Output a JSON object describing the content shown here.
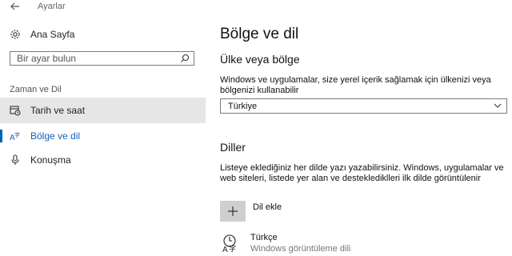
{
  "window": {
    "title": "Ayarlar"
  },
  "sidebar": {
    "home_label": "Ana Sayfa",
    "search_placeholder": "Bir ayar bulun",
    "section_label": "Zaman ve Dil",
    "items": [
      {
        "label": "Tarih ve saat",
        "icon": "calendar-clock-icon",
        "state": "selected"
      },
      {
        "label": "Bölge ve dil",
        "icon": "language-icon",
        "state": "active"
      },
      {
        "label": "Konuşma",
        "icon": "microphone-icon",
        "state": "normal"
      }
    ]
  },
  "main": {
    "title": "Bölge ve dil",
    "region": {
      "heading": "Ülke veya bölge",
      "description": "Windows ve uygulamalar, size yerel içerik sağlamak için ülkenizi veya bölgenizi kullanabilir",
      "selected_value": "Türkiye"
    },
    "languages": {
      "heading": "Diller",
      "description": "Listeye eklediğiniz her dilde yazı yazabilirsiniz. Windows, uygulamalar ve web siteleri, listede yer alan ve desteklediklleri ilk dilde görüntülenir",
      "add_label": "Dil ekle",
      "list": [
        {
          "name": "Türkçe",
          "subtitle": "Windows görüntüleme dili"
        }
      ]
    }
  },
  "colors": {
    "accent": "#0063b1",
    "selected_bg": "#e6e6e6",
    "add_button_bg": "#cfcfcf"
  }
}
